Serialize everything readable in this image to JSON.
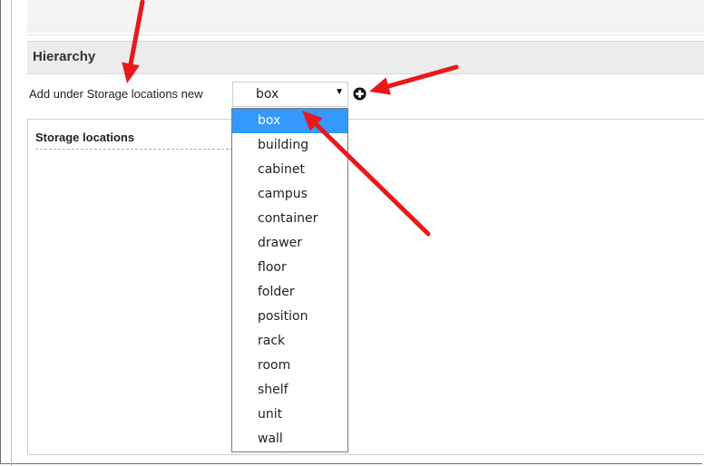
{
  "section": {
    "title": "Hierarchy"
  },
  "add_row": {
    "label": "Add under Storage locations new",
    "selected_value": "box",
    "add_icon": "plus-circle-icon"
  },
  "tree": {
    "title": "Storage locations"
  },
  "dropdown": {
    "options": [
      "box",
      "building",
      "cabinet",
      "campus",
      "container",
      "drawer",
      "floor",
      "folder",
      "position",
      "rack",
      "room",
      "shelf",
      "unit",
      "wall"
    ],
    "selected_index": 0
  },
  "colors": {
    "highlight": "#3399ff",
    "annotation_arrow": "#e8191b"
  }
}
